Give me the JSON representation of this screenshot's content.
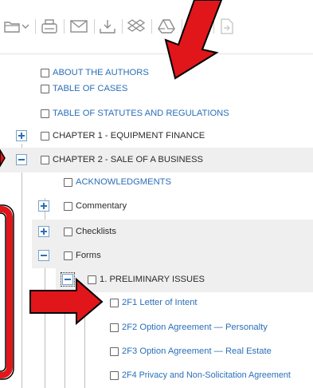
{
  "toolbar": {
    "icons": [
      "folder-icon",
      "chevron-down-icon",
      "print-icon",
      "email-icon",
      "download-icon",
      "dropbox-icon",
      "google-drive-icon",
      "onedrive-icon",
      "export-icon"
    ]
  },
  "tree": {
    "about_authors": "ABOUT THE AUTHORS",
    "table_cases": "TABLE OF CASES",
    "table_statutes": "TABLE OF STATUTES AND REGULATIONS",
    "chapter1": "CHAPTER 1 - EQUIPMENT FINANCE",
    "chapter2": "CHAPTER 2 - SALE OF A BUSINESS",
    "acknowledgments": "ACKNOWLEDGMENTS",
    "commentary": "Commentary",
    "checklists": "Checklists",
    "forms": "Forms",
    "preliminary": "1. PRELIMINARY ISSUES",
    "form_2f1": "2F1 Letter of Intent",
    "form_2f2": "2F2 Option Agreement — Personalty",
    "form_2f3": "2F3 Option Agreement — Real Estate",
    "form_2f4": "2F4 Privacy and Non-Solicitation Agreement"
  },
  "colors": {
    "link": "#2a6fb8",
    "annotation": "#e0161b",
    "highlight": "#efefef"
  }
}
